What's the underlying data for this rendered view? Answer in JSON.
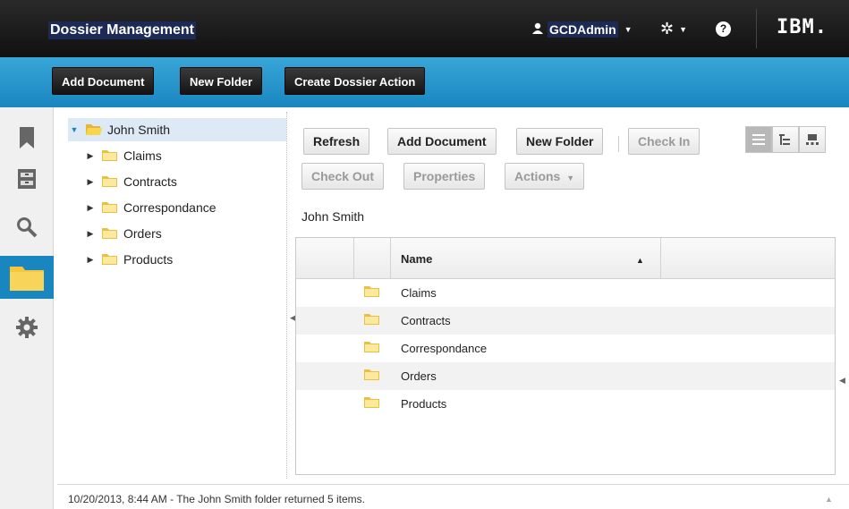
{
  "header": {
    "app_title": "Dossier Management",
    "user_name": "GCDAdmin",
    "logo_text": "IBM."
  },
  "toolbar": {
    "add_document": "Add Document",
    "new_folder": "New Folder",
    "create_dossier_action": "Create Dossier Action"
  },
  "rail": {
    "items": [
      {
        "icon": "bookmark-icon"
      },
      {
        "icon": "file-cabinet-icon"
      },
      {
        "icon": "search-icon"
      },
      {
        "icon": "folder-icon",
        "active": true
      },
      {
        "icon": "gear-icon"
      }
    ]
  },
  "tree": {
    "root": "John Smith",
    "children": [
      "Claims",
      "Contracts",
      "Correspondance",
      "Orders",
      "Products"
    ]
  },
  "actions": {
    "refresh": "Refresh",
    "add_document": "Add Document",
    "new_folder": "New Folder",
    "check_in": "Check In",
    "check_out": "Check Out",
    "properties": "Properties",
    "actions": "Actions"
  },
  "breadcrumb": "John Smith",
  "grid": {
    "column_name": "Name",
    "rows": [
      "Claims",
      "Contracts",
      "Correspondance",
      "Orders",
      "Products"
    ]
  },
  "status": "10/20/2013, 8:44 AM - The John Smith folder returned 5 items.",
  "colors": {
    "accent": "#1a86c0",
    "folder": "#f7d64a"
  }
}
